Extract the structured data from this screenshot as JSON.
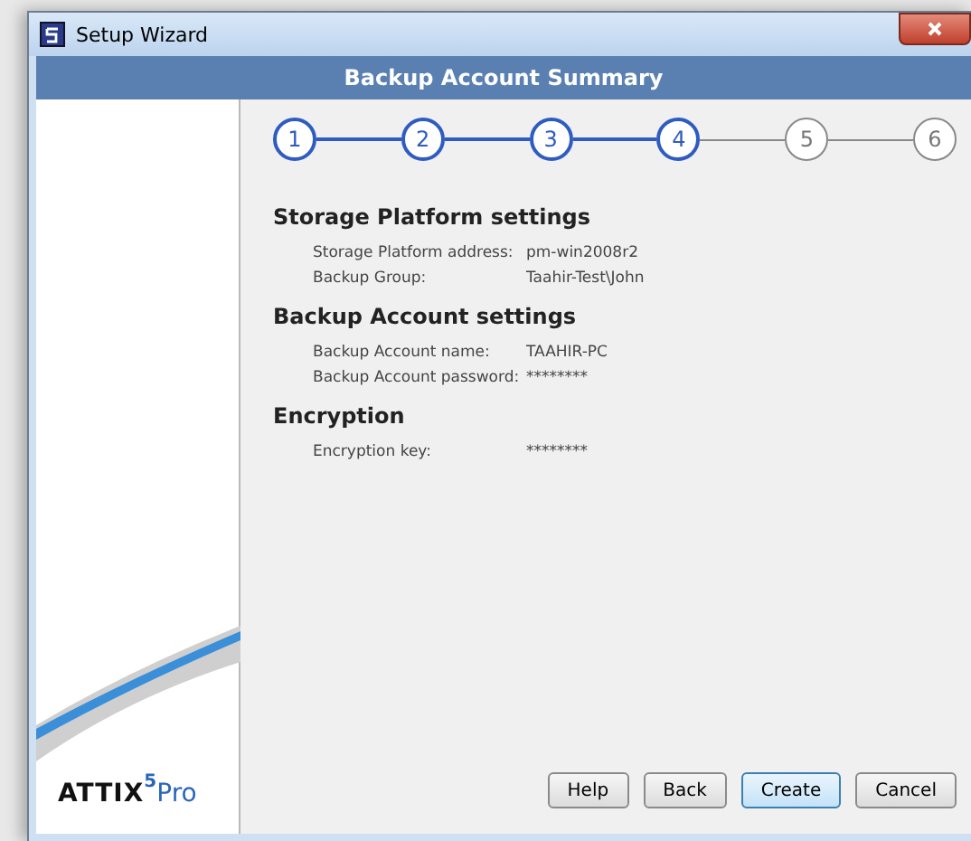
{
  "window": {
    "title": "Setup Wizard"
  },
  "header": {
    "title": "Backup Account Summary"
  },
  "steps": [
    {
      "label": "1",
      "completed": true
    },
    {
      "label": "2",
      "completed": true
    },
    {
      "label": "3",
      "completed": true
    },
    {
      "label": "4",
      "completed": true
    },
    {
      "label": "5",
      "completed": false
    },
    {
      "label": "6",
      "completed": false
    }
  ],
  "sections": [
    {
      "title": "Storage Platform settings",
      "rows": [
        {
          "label": "Storage Platform address:",
          "value": "pm-win2008r2"
        },
        {
          "label": "Backup Group:",
          "value": "Taahir-Test\\John"
        }
      ]
    },
    {
      "title": "Backup Account settings",
      "rows": [
        {
          "label": "Backup Account name:",
          "value": "TAAHIR-PC"
        },
        {
          "label": "Backup Account password:",
          "value": "********"
        }
      ]
    },
    {
      "title": "Encryption",
      "rows": [
        {
          "label": "Encryption key:",
          "value": "********"
        }
      ]
    }
  ],
  "logo": {
    "name": "ATTIX",
    "version": "5",
    "edition": "Pro"
  },
  "buttons": [
    {
      "label": "Help",
      "default": false
    },
    {
      "label": "Back",
      "default": false
    },
    {
      "label": "Create",
      "default": true
    },
    {
      "label": "Cancel",
      "default": false
    }
  ]
}
